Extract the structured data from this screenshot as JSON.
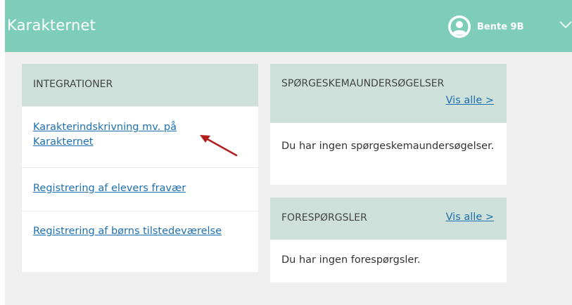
{
  "header": {
    "brand": "Karakternet",
    "user_name": "Bente 9B"
  },
  "integrationer": {
    "title": "INTEGRATIONER",
    "links": [
      "Karakterindskrivning mv. på Karakternet",
      "Registrering af elevers fravær",
      "Registrering af børns tilstedeværelse"
    ]
  },
  "spoergeskema": {
    "title": "SPØRGESKEMAUNDERSØGELSER",
    "vis_alle": "Vis alle >",
    "empty_text": "Du har ingen spørgeskemaundersøgelser."
  },
  "forespoergsler": {
    "title": "FORESPØRGSLER",
    "vis_alle": "Vis alle >",
    "empty_text": "Du har ingen forespørgsler."
  },
  "colors": {
    "topbar": "#7ecdb9",
    "panel_header": "#cde0da",
    "link": "#1e6fb0",
    "background": "#efefef",
    "annotation_arrow": "#b01e1e"
  },
  "icons": [
    "user-avatar-icon",
    "chevron-down-icon",
    "annotation-arrow-icon"
  ]
}
